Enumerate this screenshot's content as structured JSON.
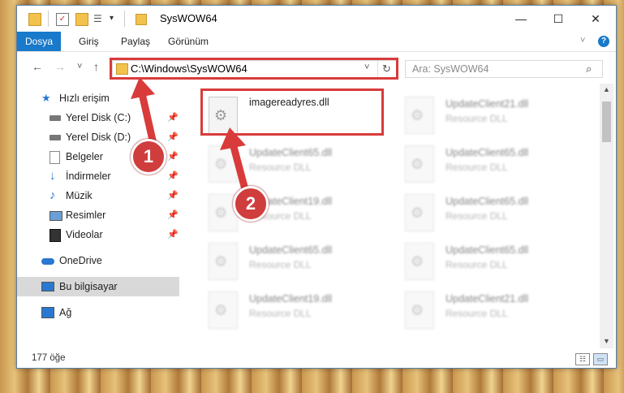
{
  "window": {
    "title": "SysWOW64",
    "controls": {
      "minimize": "—",
      "maximize": "☐",
      "close": "✕"
    }
  },
  "ribbon": {
    "tabs": [
      "Dosya",
      "Giriş",
      "Paylaş",
      "Görünüm"
    ],
    "expand_icon": "chevron-down-icon",
    "help_icon": "help-icon"
  },
  "nav": {
    "back": "←",
    "forward": "→",
    "recent": "˅",
    "up": "↑"
  },
  "address": {
    "path": "C:\\Windows\\SysWOW64"
  },
  "search": {
    "placeholder": "Ara: SysWOW64"
  },
  "sidebar": {
    "items": [
      {
        "label": "Hızlı erişim",
        "icon": "star-icon",
        "pinned": false
      },
      {
        "label": "Yerel Disk (C:)",
        "icon": "drive-icon",
        "pinned": true
      },
      {
        "label": "Yerel Disk (D:)",
        "icon": "drive-icon",
        "pinned": true
      },
      {
        "label": "Belgeler",
        "icon": "documents-icon",
        "pinned": true
      },
      {
        "label": "İndirmeler",
        "icon": "download-icon",
        "pinned": true
      },
      {
        "label": "Müzik",
        "icon": "music-icon",
        "pinned": true
      },
      {
        "label": "Resimler",
        "icon": "pictures-icon",
        "pinned": true
      },
      {
        "label": "Videolar",
        "icon": "video-icon",
        "pinned": true
      },
      {
        "label": "OneDrive",
        "icon": "cloud-icon",
        "pinned": false
      },
      {
        "label": "Bu bilgisayar",
        "icon": "computer-icon",
        "pinned": false
      },
      {
        "label": "Ağ",
        "icon": "network-icon",
        "pinned": false
      }
    ]
  },
  "files": [
    {
      "name": "imagereadyres.dll",
      "type": "",
      "blurred": false
    },
    {
      "name": "UpdateClient21.dll",
      "type": "Resource DLL",
      "blurred": true
    },
    {
      "name": "UpdateClient65.dll",
      "type": "Resource DLL",
      "blurred": true
    },
    {
      "name": "UpdateClient65.dll",
      "type": "Resource DLL",
      "blurred": true
    },
    {
      "name": "UpdateClient19.dll",
      "type": "Resource DLL",
      "blurred": true
    },
    {
      "name": "UpdateClient65.dll",
      "type": "Resource DLL",
      "blurred": true
    },
    {
      "name": "UpdateClient65.dll",
      "type": "Resource DLL",
      "blurred": true
    },
    {
      "name": "UpdateClient65.dll",
      "type": "Resource DLL",
      "blurred": true
    },
    {
      "name": "UpdateClient19.dll",
      "type": "Resource DLL",
      "blurred": true
    },
    {
      "name": "UpdateClient21.dll",
      "type": "Resource DLL",
      "blurred": true
    }
  ],
  "status": {
    "count": "177 öğe"
  },
  "annotations": {
    "step1": "1",
    "step2": "2",
    "color": "#d93b3b"
  }
}
